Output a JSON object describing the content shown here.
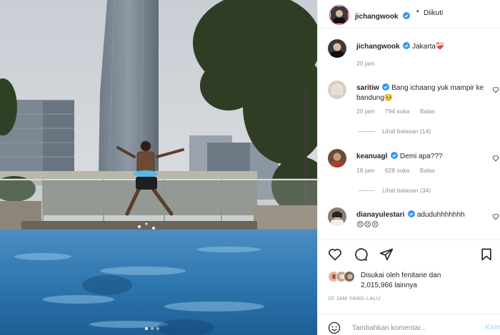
{
  "post": {
    "photo_alt": "Pria melompat ke kolam renang atap dengan latar gedung pencakar langit"
  },
  "header": {
    "username": "jichangwook",
    "dot": "•",
    "follow_status": "Diikuti"
  },
  "caption": {
    "username": "jichangwook",
    "text": "Jakarta",
    "emoji": "❤️‍🩹",
    "time": "20 jam"
  },
  "comments": [
    {
      "username": "saritiw",
      "text": "Bang ichaang yuk mampir ke bandung🥺",
      "time": "20 jam",
      "likes": "794 suka",
      "reply": "Balas",
      "view_replies": "Lihat balasan (14)"
    },
    {
      "username": "keanuagl",
      "text": "Demi apa???",
      "time": "18 jam",
      "likes": "628 suka",
      "reply": "Balas",
      "view_replies": "Lihat balasan (34)"
    },
    {
      "username": "dianayulestari",
      "text": "aduduhhhhhhh",
      "emoji": "😣😣😣",
      "time": "",
      "likes": "",
      "reply": ""
    }
  ],
  "actions": {
    "like_icon": "heart-icon",
    "comment_icon": "comment-icon",
    "share_icon": "paper-plane-icon",
    "save_icon": "bookmark-icon"
  },
  "likes": {
    "prefix": "Disukai oleh ",
    "user": "fenitarie",
    "middle": " dan",
    "count": "2,015,966 lainnya"
  },
  "date": "20 JAM YANG LALU",
  "add_comment": {
    "placeholder": "Tambahkan komentar...",
    "post_label": "Kirim"
  },
  "colors": {
    "verified": "#3897f0",
    "pool": "#2f7fb8",
    "post_disabled": "#b2dffc"
  }
}
